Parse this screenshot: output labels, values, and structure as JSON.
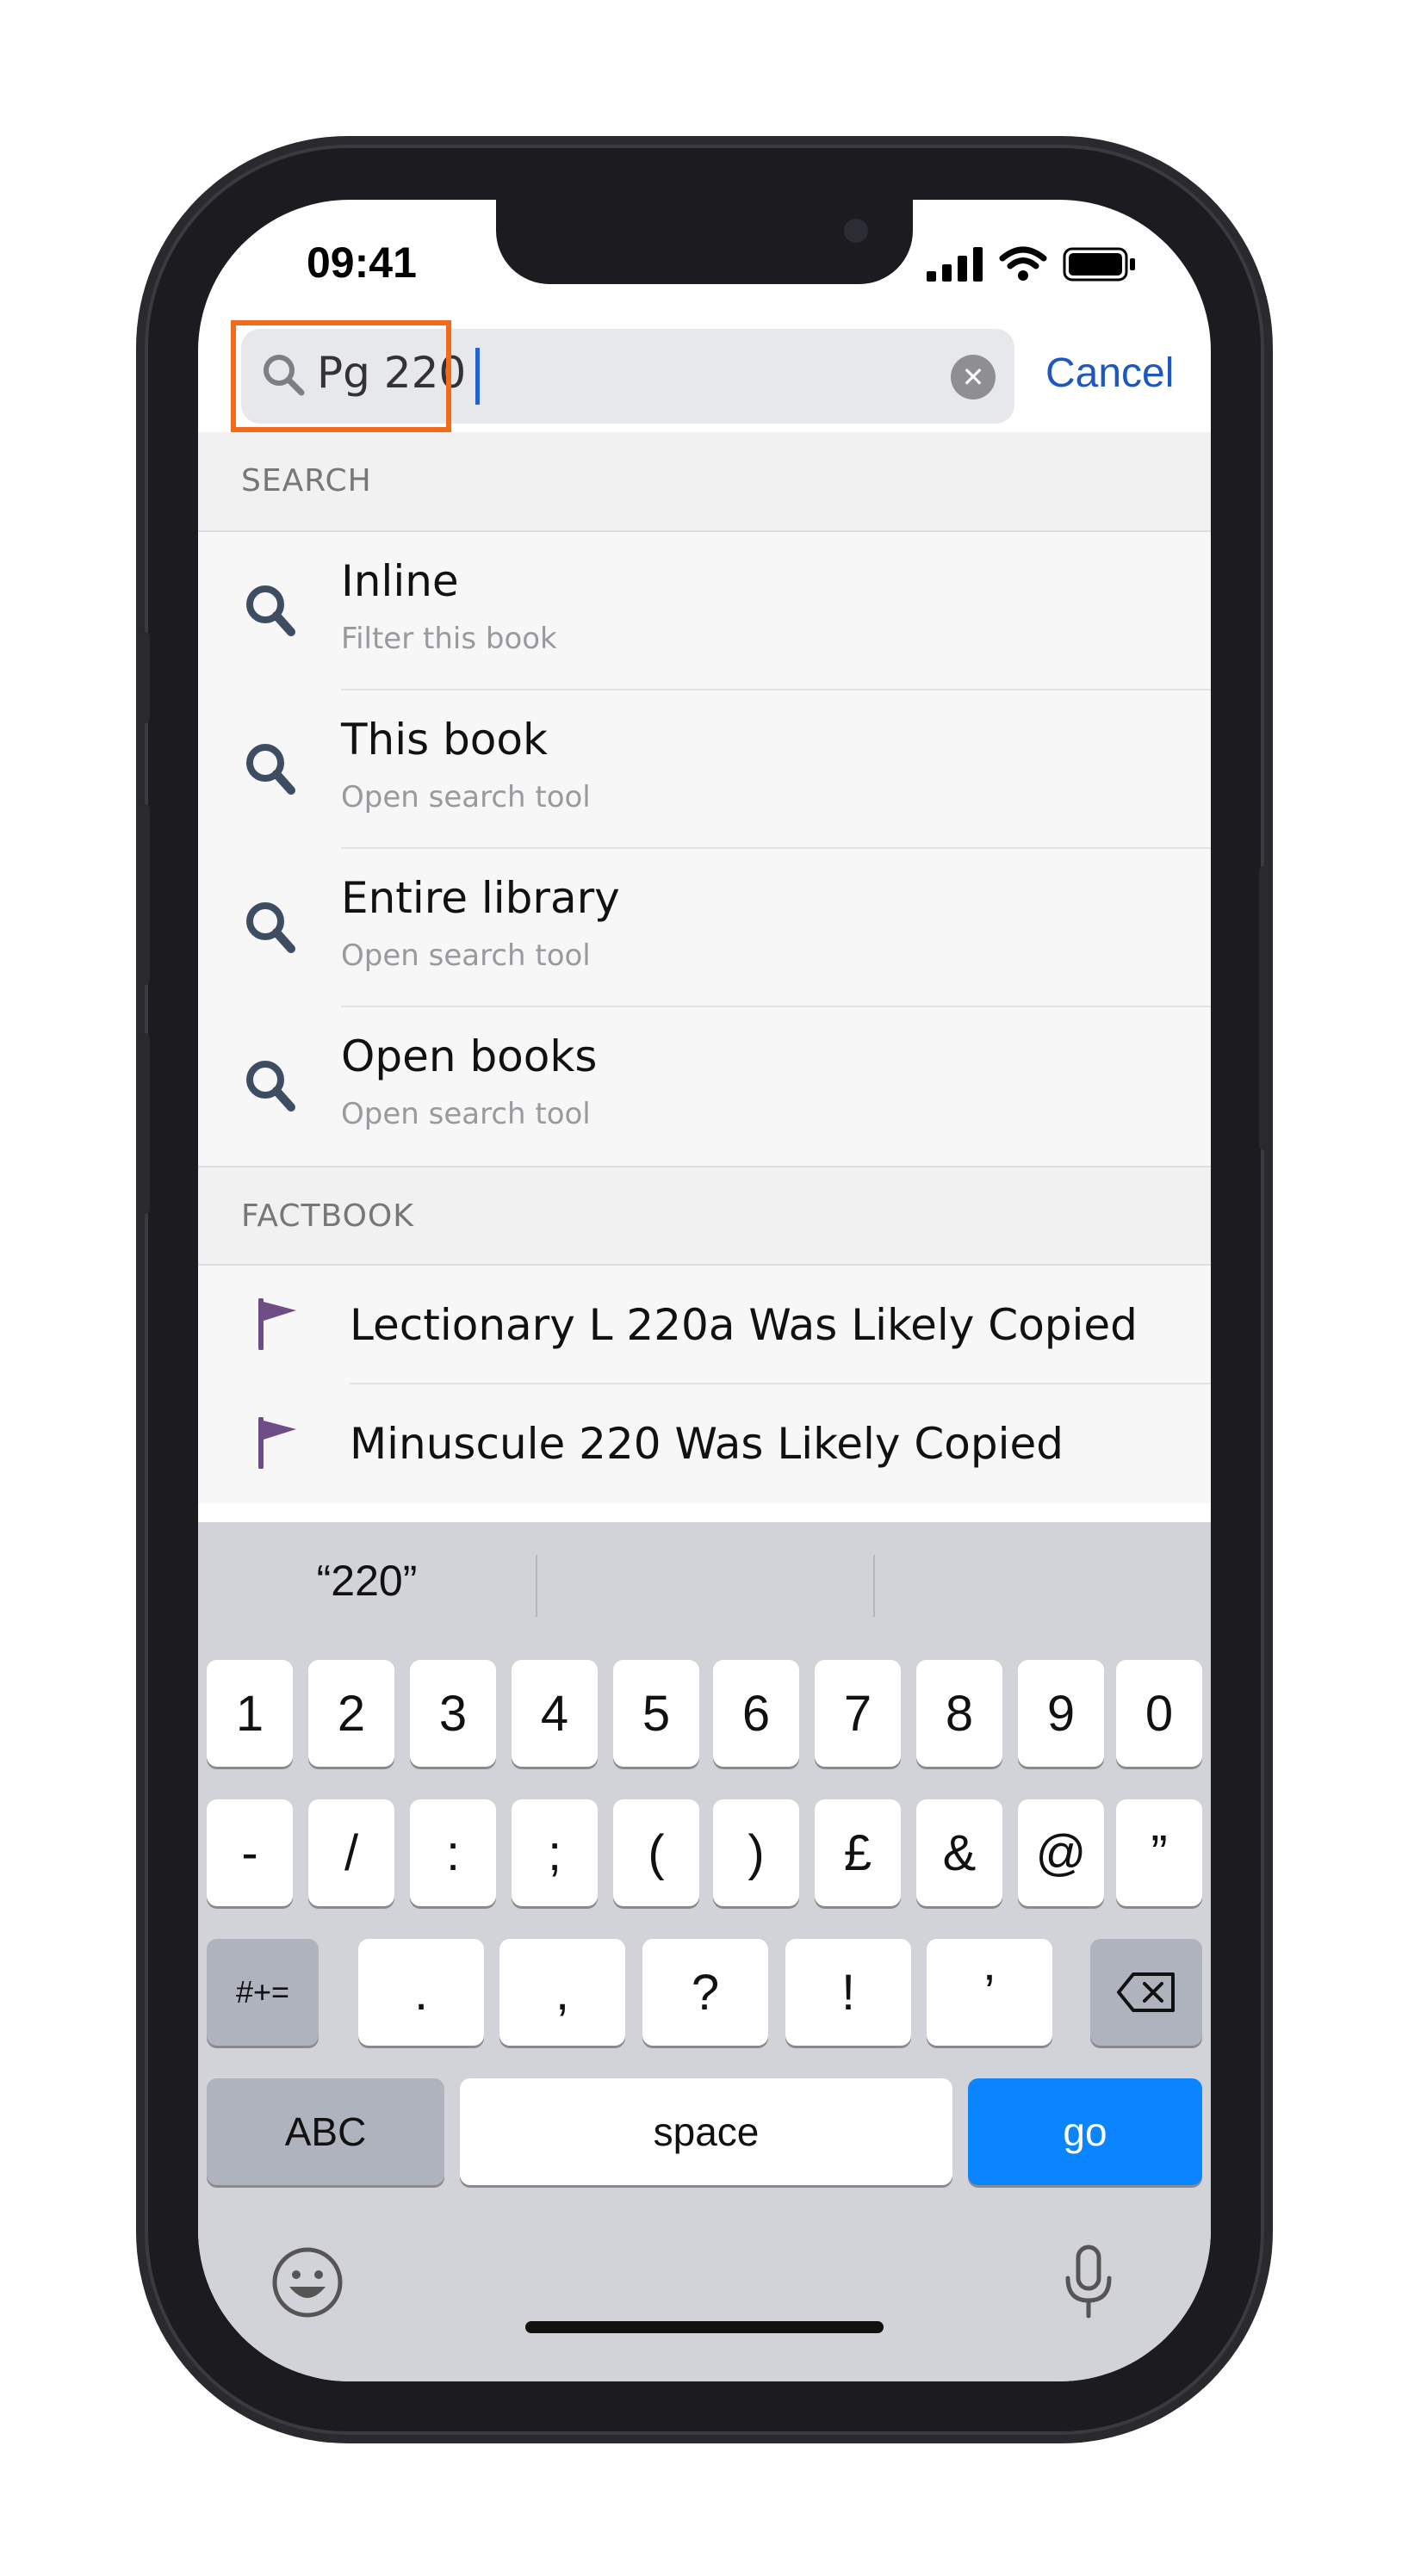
{
  "status_bar": {
    "time": "09:41"
  },
  "search": {
    "value": "Pg 220",
    "cancel_label": "Cancel"
  },
  "sections": {
    "search_header": "SEARCH",
    "search_items": [
      {
        "title": "Inline",
        "subtitle": "Filter this book"
      },
      {
        "title": "This book",
        "subtitle": "Open search tool"
      },
      {
        "title": "Entire library",
        "subtitle": "Open search tool"
      },
      {
        "title": "Open books",
        "subtitle": "Open search tool"
      }
    ],
    "factbook_header": "FACTBOOK",
    "factbook_items": [
      {
        "title": "Lectionary L 220a Was Likely Copied"
      },
      {
        "title": "Minuscule 220 Was Likely Copied"
      }
    ]
  },
  "keyboard": {
    "suggestions": [
      "“220”",
      "",
      ""
    ],
    "row1": [
      "1",
      "2",
      "3",
      "4",
      "5",
      "6",
      "7",
      "8",
      "9",
      "0"
    ],
    "row2": [
      "-",
      "/",
      ":",
      ";",
      "(",
      ")",
      "£",
      "&",
      "@",
      "”"
    ],
    "row3": [
      ".",
      ",",
      "?",
      "!",
      "’"
    ],
    "shift_label": "#+=",
    "abc_label": "ABC",
    "space_label": "space",
    "go_label": "go"
  },
  "colors": {
    "accent": "#1f57c0",
    "go_key": "#0a84ff",
    "highlight": "#f26b1d",
    "flag": "#6e4d87"
  },
  "icons": [
    "search-icon",
    "clear-icon",
    "flag-icon",
    "delete-icon",
    "emoji-icon",
    "mic-icon"
  ]
}
